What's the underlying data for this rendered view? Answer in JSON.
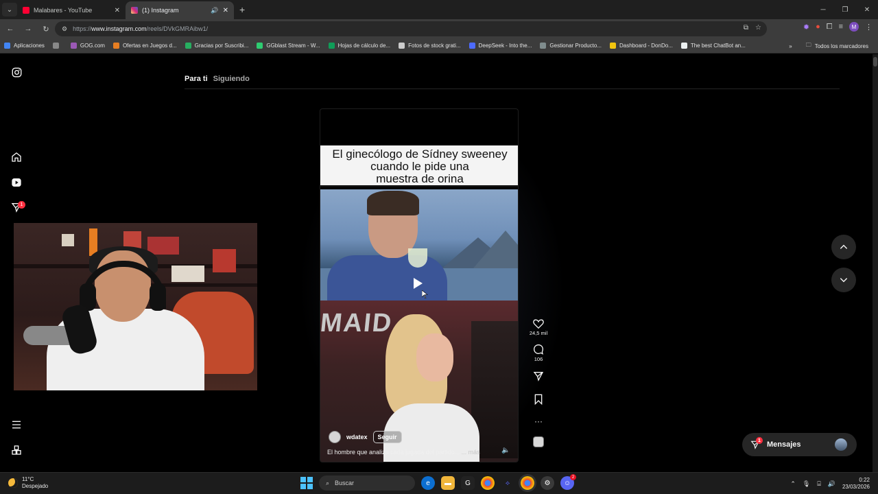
{
  "browser": {
    "tabs": [
      {
        "title": "Malabares - YouTube",
        "favicon_color": "#ff0033",
        "active": false
      },
      {
        "title": "(1) Instagram",
        "favicon_color": "#d62976",
        "active": true
      }
    ],
    "url_prefix": "https://",
    "url_domain": "www.instagram.com",
    "url_path": "/reels/DVkGMRAibw1/",
    "profile_initial": "M"
  },
  "bookmarks": [
    {
      "label": "Aplicaciones",
      "color": "#4285f4"
    },
    {
      "label": "GOG.com",
      "color": "#9b59b6"
    },
    {
      "label": "Ofertas en Juegos d...",
      "color": "#e67e22"
    },
    {
      "label": "Gracias por Suscribi...",
      "color": "#27ae60"
    },
    {
      "label": "GGblast Stream - W...",
      "color": "#2ecc71"
    },
    {
      "label": "Hojas de cálculo de...",
      "color": "#0f9d58"
    },
    {
      "label": "Fotos de stock grati...",
      "color": "#cccccc"
    },
    {
      "label": "DeepSeek - Into the...",
      "color": "#4d6bfe"
    },
    {
      "label": "Gestionar Producto...",
      "color": "#7f8c8d"
    },
    {
      "label": "Dashboard - DonDo...",
      "color": "#f1c40f"
    },
    {
      "label": "The best ChatBot an...",
      "color": "#ecf0f1"
    }
  ],
  "bookmarks_all": "Todos los marcadores",
  "instagram": {
    "feed_tabs": {
      "for_you": "Para ti",
      "following": "Siguiendo"
    },
    "notification_count": "1",
    "reel": {
      "caption_line1": "El ginecólogo de Sídney sweeney",
      "caption_line2": "cuando le pide una",
      "caption_line3": "muestra de orina",
      "wall_text": "MAID",
      "username": "wdatex",
      "follow_label": "Seguir",
      "description": "El hombre que analiza cada jugada del partido...",
      "more_label": "... más"
    },
    "actions": {
      "likes": "24,5 mil",
      "comments": "106"
    },
    "messages": {
      "label": "Mensajes",
      "count": "1"
    }
  },
  "taskbar": {
    "temperature": "11°C",
    "weather": "Despejado",
    "search_placeholder": "Buscar",
    "time": "0:22",
    "date": "23/03/2026",
    "app_badge": "2"
  }
}
